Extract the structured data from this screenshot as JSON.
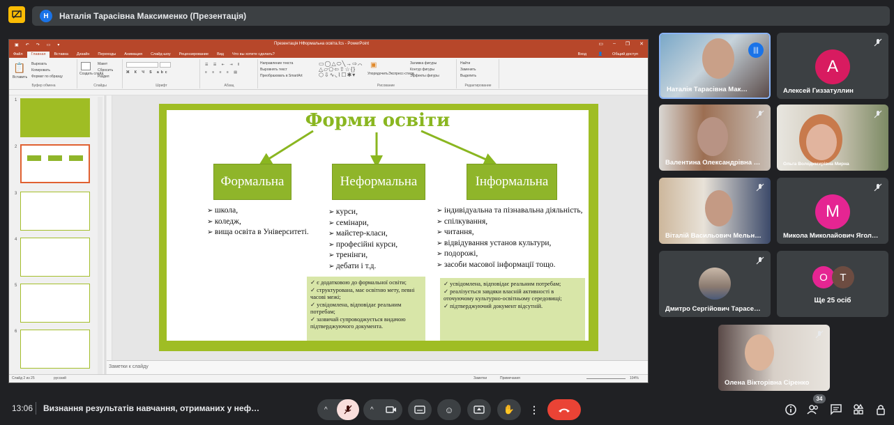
{
  "presenter": {
    "initial": "Н",
    "name": "Наталія Тарасівна Максименко (Презентація)"
  },
  "ppt": {
    "title": "Презентація НФормальна освіта.fcs - PowerPoint",
    "tabs": [
      "Файл",
      "Главная",
      "Вставка",
      "Дизайн",
      "Переходы",
      "Анимация",
      "Слайд-шоу",
      "Рецензирование",
      "Вид",
      "Что вы хотите сделать?"
    ],
    "active_tab": "Главная",
    "login": "Вход",
    "share": "Общий доступ",
    "ribbon": {
      "paste": "Вставить",
      "cut": "Вырезать",
      "copy": "Копировать",
      "format_painter": "Формат по образцу",
      "clipboard": "Буфер обмена",
      "new_slide": "Создать слайд",
      "layout": "Макет",
      "reset": "Сбросить",
      "section": "Раздел",
      "slides": "Слайды",
      "font": "Шрифт",
      "paragraph": "Абзац",
      "text_direction": "Направление текста",
      "align_text": "Выровнять текст",
      "smartart": "Преобразовать в SmartArt",
      "arrange": "Упорядочить",
      "quick_styles": "Экспресс-стили",
      "shape_fill": "Заливка фигуры",
      "shape_outline": "Контур фигуры",
      "shape_effects": "Эффекты фигуры",
      "drawing": "Рисование",
      "find": "Найти",
      "replace": "Заменить",
      "select": "Выделить",
      "editing": "Редактирование"
    },
    "notes_placeholder": "Заметки к слайду",
    "status": {
      "slide": "Слайд 2 из 25",
      "lang": "русский",
      "notes": "Заметки",
      "comments": "Примечания",
      "zoom": "104%"
    }
  },
  "slide": {
    "title": "Форми освіти",
    "formal": {
      "label": "Формальна",
      "items": [
        "школа,",
        "коледж,",
        "вища освіта в Університеті."
      ]
    },
    "nonformal": {
      "label": "Неформальна",
      "items": [
        "курси,",
        "семінари,",
        "майстер-класи,",
        "професійні курси,",
        "тренінги,",
        "дебати і т.д."
      ],
      "notes": [
        "є додатковою до формальної освіти;",
        "структурована, має освітню мету, певні часові межі;",
        "усвідомлена, відповідає реальним потребам;",
        "зазвичай супроводжується видачою підтверджуючого документа."
      ]
    },
    "informal": {
      "label": "Інформальна",
      "items": [
        "індивідуальна та пізнавальна діяльність,",
        "спілкування,",
        "читання,",
        "відвідування установ культури,",
        "подорожі,",
        "засоби масової інформації тощо."
      ],
      "notes": [
        "усвідомлена, відповідає реальним потребам;",
        "реалізується завдяки власній активності в оточуючому культурно-освітньому середовищі;",
        "підтверджуючий документ відсутній."
      ]
    }
  },
  "thumbnails": [
    "1",
    "2",
    "3",
    "4",
    "5",
    "6"
  ],
  "participants": [
    {
      "name": "Наталія Тарасівна Мак…",
      "type": "video",
      "active": true
    },
    {
      "name": "Алексей Гиззатуллин",
      "type": "avatar",
      "letter": "А",
      "color": "#d81b60"
    },
    {
      "name": "Валентина Олександрівна Є…",
      "type": "video"
    },
    {
      "name": "Ольга Володимирівна Мирна",
      "type": "video"
    },
    {
      "name": "Віталій Васильович Мельнич…",
      "type": "video"
    },
    {
      "name": "Микола Миколайович Ягольн…",
      "type": "avatar",
      "letter": "М",
      "color": "#e52592"
    },
    {
      "name": "Дмитро Сергійович Тарасен…",
      "type": "video-small"
    },
    {
      "name": "Ще 25 осіб",
      "type": "more",
      "letters": [
        "О",
        "Т"
      ]
    },
    {
      "name": "Олена Вікторівна Сіренко",
      "type": "video"
    }
  ],
  "bottom": {
    "time": "13:06",
    "meeting": "Визнання результатів навчання, отриманих у неф…",
    "participant_count": "34"
  },
  "colors": {
    "accent": "#8ab620",
    "end_call": "#ea4335",
    "mic_off": "#f9dedc"
  }
}
